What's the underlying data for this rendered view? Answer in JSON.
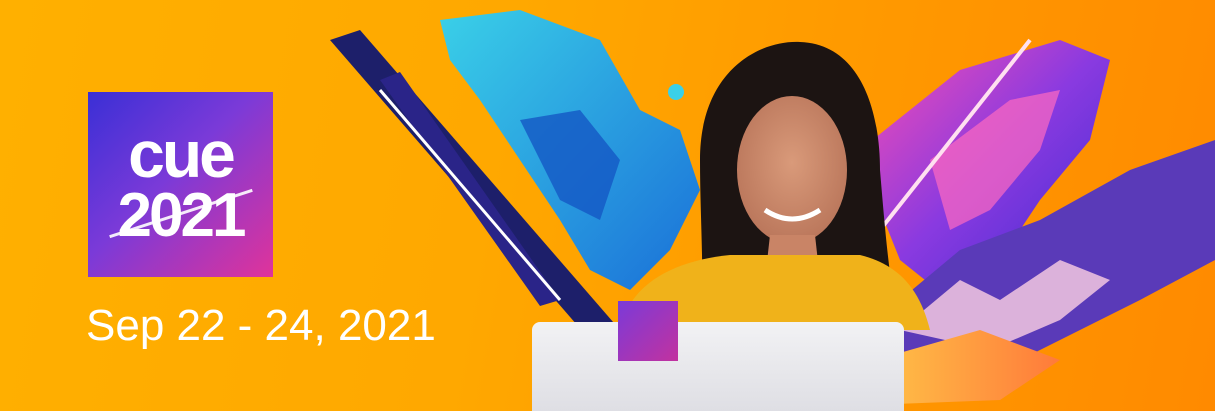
{
  "banner": {
    "logo": {
      "word": "cue",
      "year": "2021"
    },
    "dates": "Sep 22 - 24, 2021"
  },
  "colors": {
    "background": "#ffa800",
    "logo_gradient_start": "#3a2fd6",
    "logo_gradient_end": "#e0339a",
    "text": "#ffffff"
  },
  "icons": [
    "laptop-icon",
    "event-logo"
  ]
}
